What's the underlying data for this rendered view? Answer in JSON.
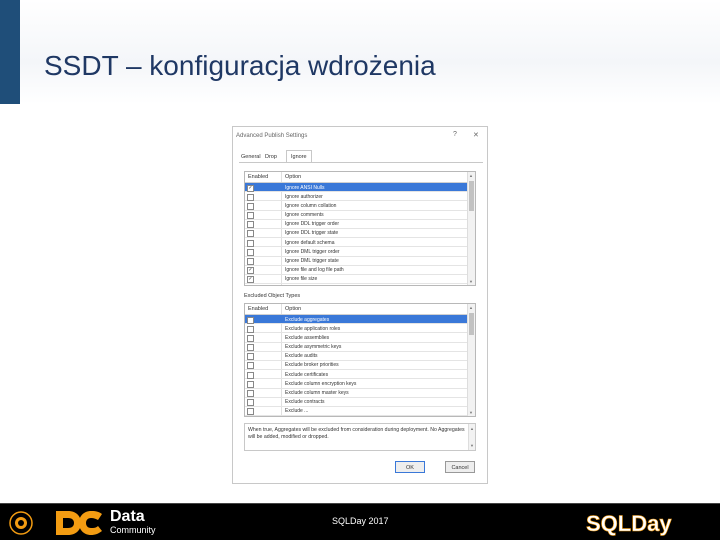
{
  "slide": {
    "title": "SSDT – konfiguracja wdrożenia"
  },
  "dialog": {
    "title": "Advanced Publish Settings",
    "help_label": "?",
    "close_label": "✕",
    "tabs": {
      "general": "General",
      "drop": "Drop",
      "ignore": "Ignore"
    },
    "ignore_grid": {
      "col_enabled": "Enabled",
      "col_option": "Option",
      "rows": [
        {
          "label": "Ignore ANSI Nulls",
          "checked": true,
          "selected": true
        },
        {
          "label": "Ignore authorizer",
          "checked": false
        },
        {
          "label": "Ignore column collation",
          "checked": false
        },
        {
          "label": "Ignore comments",
          "checked": false
        },
        {
          "label": "Ignore DDL trigger order",
          "checked": false
        },
        {
          "label": "Ignore DDL trigger state",
          "checked": false
        },
        {
          "label": "Ignore default schema",
          "checked": false
        },
        {
          "label": "Ignore DML trigger order",
          "checked": false
        },
        {
          "label": "Ignore DML trigger state",
          "checked": false
        },
        {
          "label": "Ignore file and log file path",
          "checked": true
        },
        {
          "label": "Ignore file size",
          "checked": true
        }
      ]
    },
    "excluded_section_label": "Excluded Object Types",
    "excluded_grid": {
      "col_enabled": "Enabled",
      "col_option": "Option",
      "rows": [
        {
          "label": "Exclude aggregates",
          "checked": false,
          "selected": true
        },
        {
          "label": "Exclude application roles",
          "checked": false
        },
        {
          "label": "Exclude assemblies",
          "checked": false
        },
        {
          "label": "Exclude asymmetric keys",
          "checked": false
        },
        {
          "label": "Exclude audits",
          "checked": false
        },
        {
          "label": "Exclude broker priorities",
          "checked": false
        },
        {
          "label": "Exclude certificates",
          "checked": false
        },
        {
          "label": "Exclude column encryption keys",
          "checked": false
        },
        {
          "label": "Exclude column master keys",
          "checked": false
        },
        {
          "label": "Exclude contracts",
          "checked": false
        },
        {
          "label": "Exclude ...",
          "checked": false
        }
      ]
    },
    "description": "When true, Aggregates will be excluded from consideration during deployment. No Aggregates will be added, modified or dropped.",
    "ok_label": "OK",
    "cancel_label": "Cancel"
  },
  "footer": {
    "brand_data": "Data",
    "brand_community": "Community",
    "event_text": "SQLDay 2017",
    "sqlday_logo": "SQLDay"
  },
  "colors": {
    "title": "#1f3864",
    "accent_bar": "#1f4e79",
    "selection": "#3a78d8",
    "brand_orange": "#f39c12",
    "footer_bg": "#000000"
  }
}
